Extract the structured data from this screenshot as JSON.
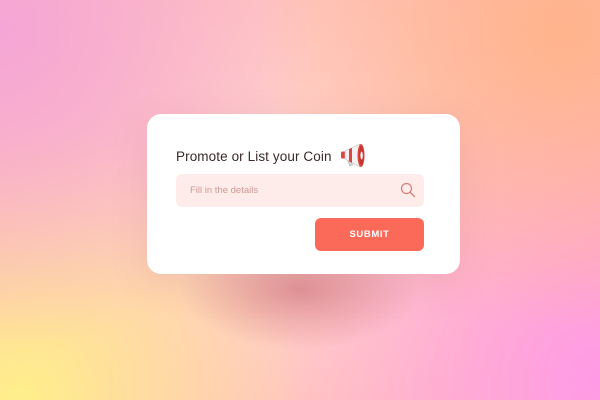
{
  "card": {
    "title": "Promote or List your Coin",
    "title_icon": "megaphone-icon"
  },
  "form": {
    "input": {
      "value": "",
      "placeholder": "Fill in the details",
      "icon": "search-icon"
    },
    "submit_label": "SUBMIT"
  },
  "colors": {
    "accent": "#fb6a58",
    "input_background": "#fdecea",
    "card_background": "#ffffff",
    "title_text": "#3a2a2a"
  }
}
